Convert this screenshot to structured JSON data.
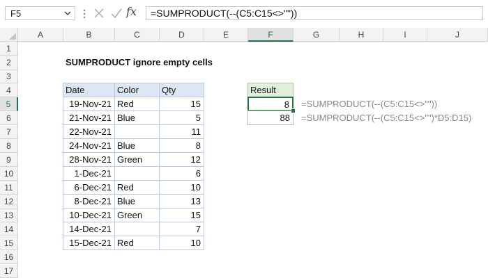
{
  "formula_bar": {
    "name_box": "F5",
    "formula": "=SUMPRODUCT(--(C5:C15<>\"\"))",
    "fx_label": "fx"
  },
  "columns": [
    "A",
    "B",
    "C",
    "D",
    "E",
    "F",
    "G",
    "H",
    "I",
    "J"
  ],
  "rows": [
    "1",
    "2",
    "3",
    "4",
    "5",
    "6",
    "7",
    "8",
    "9",
    "10",
    "11",
    "12",
    "13",
    "14",
    "15",
    "16",
    "17"
  ],
  "active_cell": {
    "column": "F",
    "row": "5"
  },
  "title": "SUMPRODUCT ignore empty cells",
  "table": {
    "headers": [
      "Date",
      "Color",
      "Qty"
    ],
    "rows": [
      [
        "19-Nov-21",
        "Red",
        "15"
      ],
      [
        "21-Nov-21",
        "Blue",
        "5"
      ],
      [
        "22-Nov-21",
        "",
        "11"
      ],
      [
        "24-Nov-21",
        "Blue",
        "8"
      ],
      [
        "28-Nov-21",
        "Green",
        "12"
      ],
      [
        "1-Dec-21",
        "",
        "6"
      ],
      [
        "6-Dec-21",
        "Red",
        "10"
      ],
      [
        "8-Dec-21",
        "Blue",
        "13"
      ],
      [
        "10-Dec-21",
        "Green",
        "15"
      ],
      [
        "14-Dec-21",
        "",
        "7"
      ],
      [
        "15-Dec-21",
        "Red",
        "10"
      ]
    ]
  },
  "result": {
    "header": "Result",
    "values": [
      "8",
      "88"
    ],
    "formulas": [
      "=SUMPRODUCT(--(C5:C15<>\"\"))",
      "=SUMPRODUCT(--(C5:C15<>\"\")*D5:D15)"
    ]
  },
  "colors": {
    "accent": "#217346",
    "table_header": "#dde7f3",
    "result_header": "#e2efda"
  }
}
